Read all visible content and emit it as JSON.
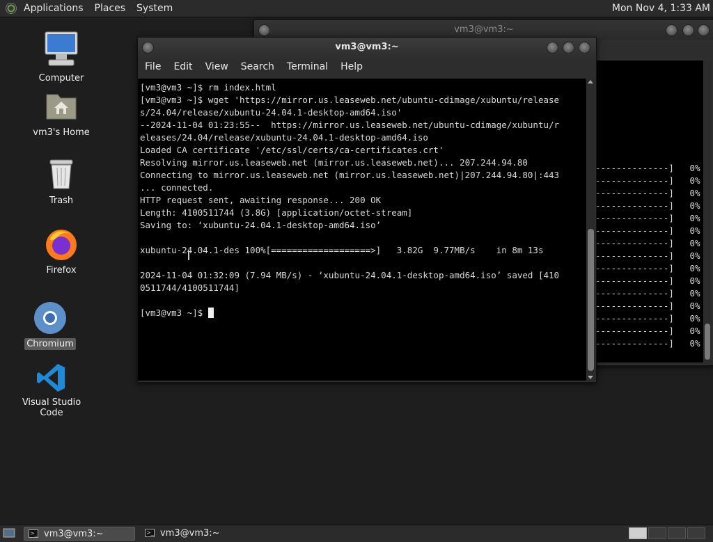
{
  "top_panel": {
    "menus": [
      "Applications",
      "Places",
      "System"
    ],
    "clock": "Mon Nov 4, 1:33 AM"
  },
  "desktop": {
    "icons": [
      {
        "label": "Computer",
        "icon": "computer-icon"
      },
      {
        "label": "vm3's Home",
        "icon": "home-folder-icon"
      },
      {
        "label": "Trash",
        "icon": "trash-icon"
      },
      {
        "label": "Firefox",
        "icon": "firefox-icon"
      },
      {
        "label": "Chromium",
        "icon": "chromium-icon",
        "selected": true
      },
      {
        "label": "Visual Studio Code",
        "icon": "vscode-icon"
      }
    ]
  },
  "back_window": {
    "title": "vm3@vm3:~",
    "progress_rows": [
      {
        "bar": "--------------]",
        "percent": "0%"
      },
      {
        "bar": "--------------]",
        "percent": "0%"
      },
      {
        "bar": "--------------]",
        "percent": "0%"
      },
      {
        "bar": "--------------]",
        "percent": "0%"
      },
      {
        "bar": "--------------]",
        "percent": "0%"
      },
      {
        "bar": "--------------]",
        "percent": "0%"
      },
      {
        "bar": "--------------]",
        "percent": "0%"
      },
      {
        "bar": "--------------]",
        "percent": "0%"
      },
      {
        "bar": "--------------]",
        "percent": "0%"
      },
      {
        "bar": "--------------]",
        "percent": "0%"
      },
      {
        "bar": "--------------]",
        "percent": "0%"
      },
      {
        "bar": "--------------]",
        "percent": "0%"
      },
      {
        "bar": "--------------]",
        "percent": "0%"
      },
      {
        "bar": "--------------]",
        "percent": "0%"
      },
      {
        "bar": "--------------]",
        "percent": "0%"
      }
    ]
  },
  "front_window": {
    "title": "vm3@vm3:~",
    "menu": [
      "File",
      "Edit",
      "View",
      "Search",
      "Terminal",
      "Help"
    ],
    "terminal_lines": [
      "[vm3@vm3 ~]$ rm index.html",
      "[vm3@vm3 ~]$ wget 'https://mirror.us.leaseweb.net/ubuntu-cdimage/xubuntu/release",
      "s/24.04/release/xubuntu-24.04.1-desktop-amd64.iso'",
      "--2024-11-04 01:23:55--  https://mirror.us.leaseweb.net/ubuntu-cdimage/xubuntu/r",
      "eleases/24.04/release/xubuntu-24.04.1-desktop-amd64.iso",
      "Loaded CA certificate '/etc/ssl/certs/ca-certificates.crt'",
      "Resolving mirror.us.leaseweb.net (mirror.us.leaseweb.net)... 207.244.94.80",
      "Connecting to mirror.us.leaseweb.net (mirror.us.leaseweb.net)|207.244.94.80|:443",
      "... connected.",
      "HTTP request sent, awaiting response... 200 OK",
      "Length: 4100511744 (3.8G) [application/octet-stream]",
      "Saving to: ‘xubuntu-24.04.1-desktop-amd64.iso’",
      "",
      "xubuntu-24.04.1-des 100%[===================>]   3.82G  9.77MB/s    in 8m 13s",
      "",
      "2024-11-04 01:32:09 (7.94 MB/s) - ‘xubuntu-24.04.1-desktop-amd64.iso’ saved [410",
      "0511744/4100511744]",
      "",
      "[vm3@vm3 ~]$ "
    ]
  },
  "taskbar": {
    "tasks": [
      {
        "label": "vm3@vm3:~",
        "active": true
      },
      {
        "label": "vm3@vm3:~",
        "active": false
      }
    ]
  }
}
